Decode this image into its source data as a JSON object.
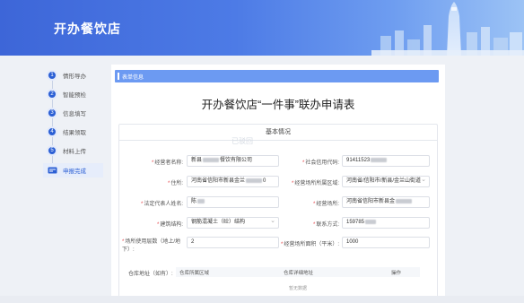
{
  "header": {
    "title": "开办餐饮店"
  },
  "sidebar": {
    "steps": [
      {
        "num": "1",
        "label": "情形导办"
      },
      {
        "num": "2",
        "label": "智能预检"
      },
      {
        "num": "3",
        "label": "信息填写"
      },
      {
        "num": "4",
        "label": "结果领取"
      },
      {
        "num": "5",
        "label": "材料上传"
      },
      {
        "num": "",
        "label": "申报完成"
      }
    ],
    "active_index": 5
  },
  "section": {
    "title": "表单信息"
  },
  "form": {
    "title": "开办餐饮店“一件事”联办申请表",
    "card_title": "基本情况",
    "watermark": "已驳回",
    "fields": {
      "operator_name": {
        "label": "经营者名称:",
        "value_prefix": "新县",
        "value_suffix": "餐饮有限公司"
      },
      "credit_code": {
        "label": "社会信用代码:",
        "value": "91411523"
      },
      "address": {
        "label": "住所:",
        "value_prefix": "河南省信阳市新县金兰",
        "value_suffix": "0"
      },
      "admin_area": {
        "label": "经营场所所属区域:",
        "value": "河南省/信阳市/新县/金兰山街道"
      },
      "legal_rep": {
        "label": "法定代表人姓名:",
        "value": "陈"
      },
      "premises": {
        "label": "经营场所:",
        "value_prefix": "河南省信阳市新县金"
      },
      "building": {
        "label": "建筑结构:",
        "value": "钢筋混凝土（砼）结构"
      },
      "contact": {
        "label": "联系方式:",
        "value": "159785"
      },
      "floors": {
        "label": "场所使用层数（地上/地下）:",
        "value": "2"
      },
      "area": {
        "label": "经营场所面积（平米）:",
        "value": "1000"
      }
    },
    "warehouse": {
      "label": "仓库地址（如有）:",
      "columns": [
        "仓库所属区域",
        "仓库详细地址",
        "操作"
      ],
      "empty_text": "暂无数据"
    }
  },
  "colors": {
    "brand": "#2b5fd4",
    "section_bar": "#6c9af2",
    "required": "#e5484d"
  }
}
